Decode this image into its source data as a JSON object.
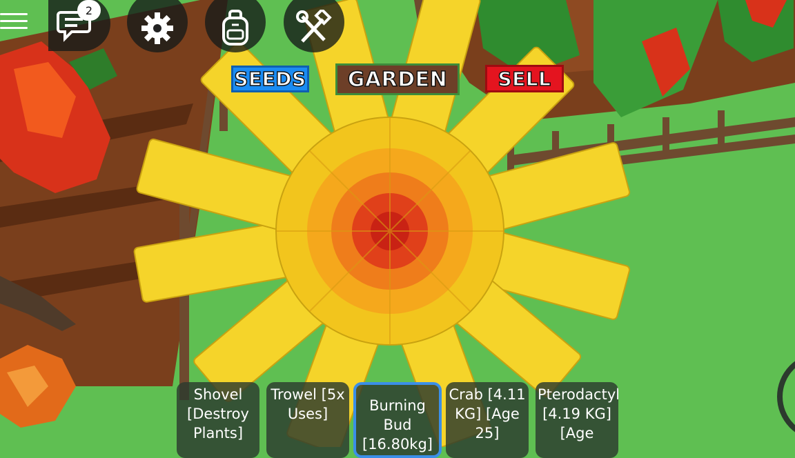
{
  "top_bar": {
    "menu_icon": "hamburger-menu-icon",
    "chat_icon": "chat-icon",
    "chat_badge": "2",
    "settings_icon": "gear-icon",
    "backpack_icon": "backpack-icon",
    "tools_icon": "hammer-wrench-icon"
  },
  "nav": {
    "seeds": "SEEDS",
    "garden": "GARDEN",
    "sell": "SELL"
  },
  "hotbar": [
    {
      "label": "Shovel [Destroy Plants]"
    },
    {
      "label": "Trowel [5x Uses]"
    },
    {
      "label": "Burning Bud [16.80kg]"
    },
    {
      "label": "Crab [4.11 KG] [Age 25]"
    },
    {
      "label": "Pterodactyl [4.19 KG] [Age"
    }
  ],
  "colors": {
    "grass": "#5fbf52",
    "seeds_bg": "#1b8cf3",
    "garden_bg": "#6d3f28",
    "sell_bg": "#e4141f",
    "selected_slot_border": "#3b8fe8"
  }
}
